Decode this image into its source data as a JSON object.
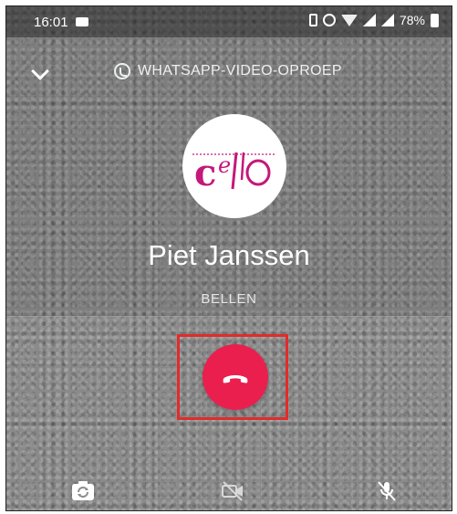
{
  "status_bar": {
    "time": "16:01",
    "battery": "78%"
  },
  "header": {
    "call_type_label": "WHATSAPP-VIDEO-OPROEP"
  },
  "contact": {
    "name": "Piet Janssen",
    "avatar_logo_text": "cello"
  },
  "call": {
    "status": "BELLEN"
  },
  "controls": {
    "end_call_icon": "phone-hangup-icon",
    "switch_camera_icon": "switch-camera-icon",
    "video_off_icon": "video-off-icon",
    "mute_icon": "mic-off-icon"
  },
  "colors": {
    "end_call": "#ea1f4e",
    "highlight_box": "#e32b2b",
    "logo": "#c4187a"
  }
}
